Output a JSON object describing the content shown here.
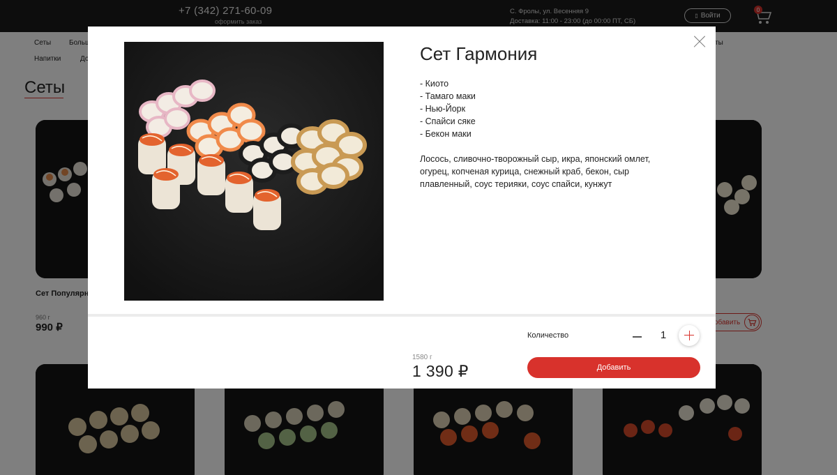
{
  "header": {
    "phone": "+7 (342) 271-60-09",
    "order_link": "оформить заказ",
    "address_line1": "С. Фролы, ул. Весенняя 9",
    "address_line2": "Доставка: 11:00 - 23:00 (до 00:00 ПТ, СБ)",
    "login_label": "Войти",
    "cart_count": "0"
  },
  "nav": {
    "items": [
      "Сеты",
      "Больш",
      "ты",
      "Напитки",
      "До"
    ]
  },
  "section_title": "Сеты",
  "cards": [
    {
      "name": "Сет Популярн",
      "weight": "960 г",
      "price": "990 ₽"
    }
  ],
  "card_add_label": "Добавить",
  "modal": {
    "title": "Сет Гармония",
    "composition": [
      "- Киото",
      "- Тамаго маки",
      "- Нью-Йорк",
      "- Спайси сяке",
      "- Бекон маки"
    ],
    "ingredients": "Лосось, сливочно-творожный сыр, икра, японский омлет, огурец, копченая курица, снежный краб, бекон, сыр плавленный, соус терияки, соус спайси, кунжут",
    "quantity_label": "Количество",
    "quantity": "1",
    "weight": "1580 г",
    "price": "1 390 ₽",
    "add_label": "Добавить"
  },
  "colors": {
    "accent": "#d8322c",
    "topbar": "#1a1a1a",
    "overlay": "rgba(0,0,0,0.5)"
  }
}
